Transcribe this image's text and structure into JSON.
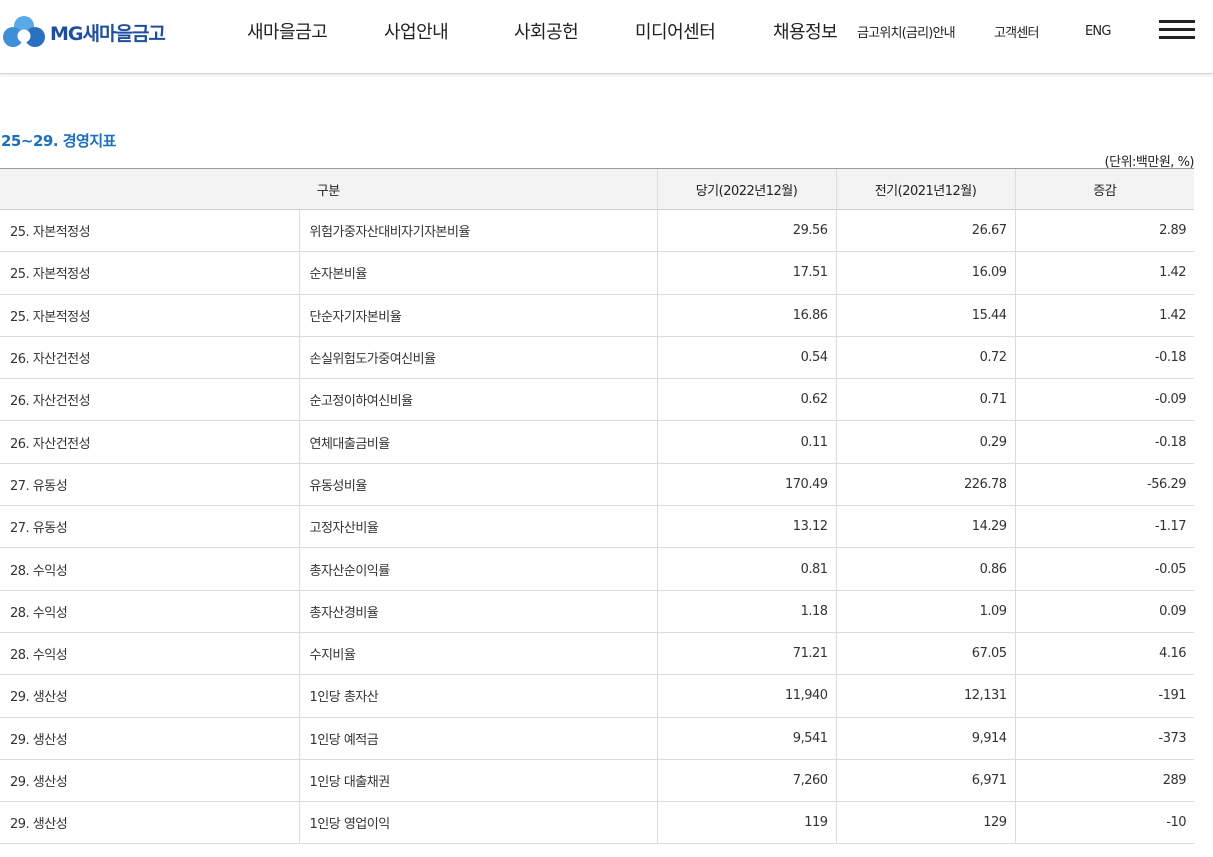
{
  "header": {
    "logo_text": "MG새마을금고",
    "nav_main": [
      "새마을금고",
      "사업안내",
      "사회공헌",
      "미디어센터",
      "채용정보"
    ],
    "nav_util": [
      "금고위치(금리)안내",
      "고객센터",
      "ENG"
    ],
    "colors": {
      "logo_blue": "#1f4e9c",
      "logo_light": "#5aa9e6"
    }
  },
  "section": {
    "title": "25~29. 경영지표",
    "unit": "(단위:백만원, %)",
    "title_color": "#1a6fbf"
  },
  "table": {
    "headers": [
      "구분",
      "당기(2022년12월)",
      "전기(2021년12월)",
      "증감"
    ],
    "rows": [
      {
        "category": "25. 자본적정성",
        "item": "위험가중자산대비자기자본비율",
        "current": "29.56",
        "previous": "26.67",
        "change": "2.89"
      },
      {
        "category": "25. 자본적정성",
        "item": "순자본비율",
        "current": "17.51",
        "previous": "16.09",
        "change": "1.42"
      },
      {
        "category": "25. 자본적정성",
        "item": "단순자기자본비율",
        "current": "16.86",
        "previous": "15.44",
        "change": "1.42"
      },
      {
        "category": "26. 자산건전성",
        "item": "손실위험도가중여신비율",
        "current": "0.54",
        "previous": "0.72",
        "change": "-0.18"
      },
      {
        "category": "26. 자산건전성",
        "item": "순고정이하여신비율",
        "current": "0.62",
        "previous": "0.71",
        "change": "-0.09"
      },
      {
        "category": "26. 자산건전성",
        "item": "연체대출금비율",
        "current": "0.11",
        "previous": "0.29",
        "change": "-0.18"
      },
      {
        "category": "27. 유동성",
        "item": "유동성비율",
        "current": "170.49",
        "previous": "226.78",
        "change": "-56.29"
      },
      {
        "category": "27. 유동성",
        "item": "고정자산비율",
        "current": "13.12",
        "previous": "14.29",
        "change": "-1.17"
      },
      {
        "category": "28. 수익성",
        "item": "총자산순이익률",
        "current": "0.81",
        "previous": "0.86",
        "change": "-0.05"
      },
      {
        "category": "28. 수익성",
        "item": "총자산경비율",
        "current": "1.18",
        "previous": "1.09",
        "change": "0.09"
      },
      {
        "category": "28. 수익성",
        "item": "수지비율",
        "current": "71.21",
        "previous": "67.05",
        "change": "4.16"
      },
      {
        "category": "29. 생산성",
        "item": "1인당 총자산",
        "current": "11,940",
        "previous": "12,131",
        "change": "-191"
      },
      {
        "category": "29. 생산성",
        "item": "1인당 예적금",
        "current": "9,541",
        "previous": "9,914",
        "change": "-373"
      },
      {
        "category": "29. 생산성",
        "item": "1인당 대출채권",
        "current": "7,260",
        "previous": "6,971",
        "change": "289"
      },
      {
        "category": "29. 생산성",
        "item": "1인당 영업이익",
        "current": "119",
        "previous": "129",
        "change": "-10"
      }
    ]
  }
}
